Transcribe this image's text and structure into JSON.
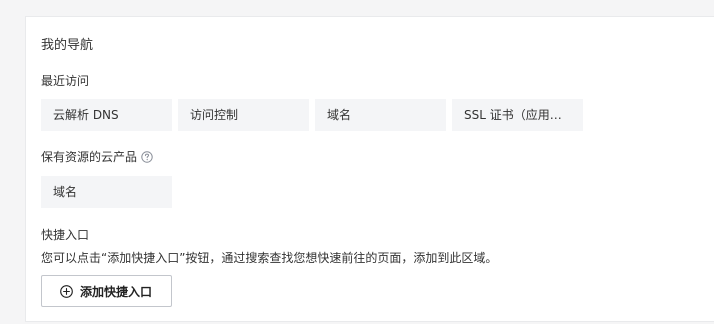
{
  "nav": {
    "title": "我的导航",
    "recent": {
      "label": "最近访问",
      "items": [
        "云解析 DNS",
        "访问控制",
        "域名",
        "SSL 证书（应用安..."
      ]
    },
    "saved": {
      "label": "保有资源的云产品",
      "help_icon": "question-circle-icon",
      "items": [
        "域名"
      ]
    },
    "shortcut": {
      "label": "快捷入口",
      "description": "您可以点击“添加快捷入口”按钮，通过搜索查找您想快速前往的页面，添加到此区域。",
      "add_button_label": "添加快捷入口",
      "add_icon": "plus-circle-icon"
    }
  },
  "colors": {
    "page_bg": "#f5f5f6",
    "item_bg": "#f4f5f7",
    "border": "#c3c6cc",
    "text": "#333333"
  }
}
